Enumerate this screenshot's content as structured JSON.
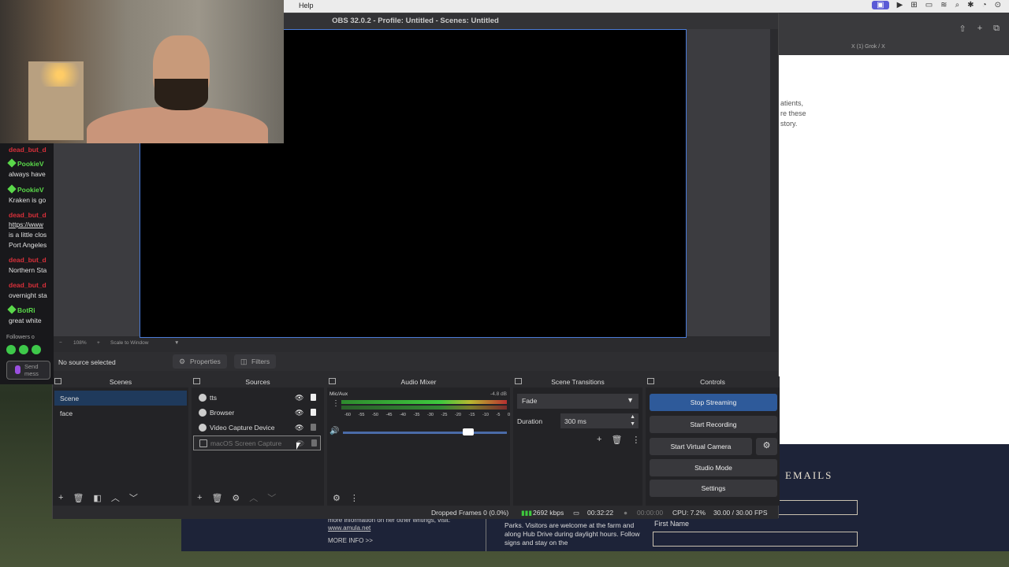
{
  "menubar": {
    "help_label": "Help",
    "icons": [
      "◐",
      "▣",
      "▶",
      "⊞",
      "▭",
      "≋",
      "⌕",
      "✱",
      "◔",
      "⊙"
    ]
  },
  "browser": {
    "tab_label": "X  (1) Grok / X",
    "body_lines": [
      "atients,",
      "re these",
      "story."
    ]
  },
  "website": {
    "emails_heading": "EMAILS",
    "first_name_label": "First Name",
    "col1_text": "more information on her other writings, visit:",
    "col1_link": "www.amula.net",
    "col1_more": "MORE INFO >>",
    "col2_text": "Parks. Visitors are welcome at the farm and along Hub Drive during daylight hours. Follow signs and stay on the"
  },
  "chat": {
    "lines": [
      {
        "user": "dead_but_d",
        "msg": ""
      },
      {
        "user": "PookieV",
        "msg": "always have"
      },
      {
        "user": "PookieV",
        "msg": "Kraken is go"
      },
      {
        "user": "dead_but_d",
        "link": "https://www",
        "msg": "is a little clos",
        "msg2": "Port Angeles"
      },
      {
        "user": "dead_but_d",
        "msg": "Northern Sta"
      },
      {
        "user": "dead_but_d",
        "msg": "overnight sta"
      },
      {
        "user": "BotRi",
        "msg": "great white"
      }
    ],
    "followers_label": "Followers o",
    "send_placeholder": "Send mess"
  },
  "obs": {
    "title": "OBS 32.0.2 - Profile: Untitled - Scenes: Untitled",
    "zoom": {
      "minus": "−",
      "level": "108%",
      "plus": "+",
      "mode": "Scale to Window"
    },
    "no_source": "No source selected",
    "properties_label": "Properties",
    "filters_label": "Filters",
    "docks": {
      "scenes_title": "Scenes",
      "sources_title": "Sources",
      "mixer_title": "Audio Mixer",
      "transitions_title": "Scene Transitions",
      "controls_title": "Controls"
    },
    "scenes": [
      {
        "name": "Scene",
        "selected": true
      },
      {
        "name": "face",
        "selected": false
      }
    ],
    "sources": [
      {
        "name": "tts",
        "visible": true,
        "locked": true
      },
      {
        "name": "Browser",
        "visible": true,
        "locked": true
      },
      {
        "name": "Video Capture Device",
        "visible": true,
        "locked": false
      },
      {
        "name": "macOS Screen Capture",
        "visible": false,
        "locked": false,
        "selected": true
      }
    ],
    "mixer": {
      "channel": "Mic/Aux",
      "level_db": "-4.8 dB",
      "scale": [
        "-60",
        "-55",
        "-50",
        "-45",
        "-40",
        "-35",
        "-30",
        "-25",
        "-20",
        "-15",
        "-10",
        "-5",
        "0"
      ],
      "volume": 0.82
    },
    "transitions": {
      "selected": "Fade",
      "duration_label": "Duration",
      "duration_value": "300 ms"
    },
    "controls": {
      "stop_streaming": "Stop Streaming",
      "start_recording": "Start Recording",
      "start_virtual_camera": "Start Virtual Camera",
      "studio_mode": "Studio Mode",
      "settings": "Settings"
    },
    "status": {
      "dropped_frames": "Dropped Frames 0 (0.0%)",
      "bitrate": "2692 kbps",
      "stream_time": "00:32:22",
      "rec_time": "00:00:00",
      "cpu": "CPU: 7.2%",
      "fps": "30.00 / 30.00 FPS"
    }
  },
  "colors": {
    "accent": "#2e5a9a",
    "preview_border": "#4a7bd8",
    "selection": "#1f3a5c"
  }
}
